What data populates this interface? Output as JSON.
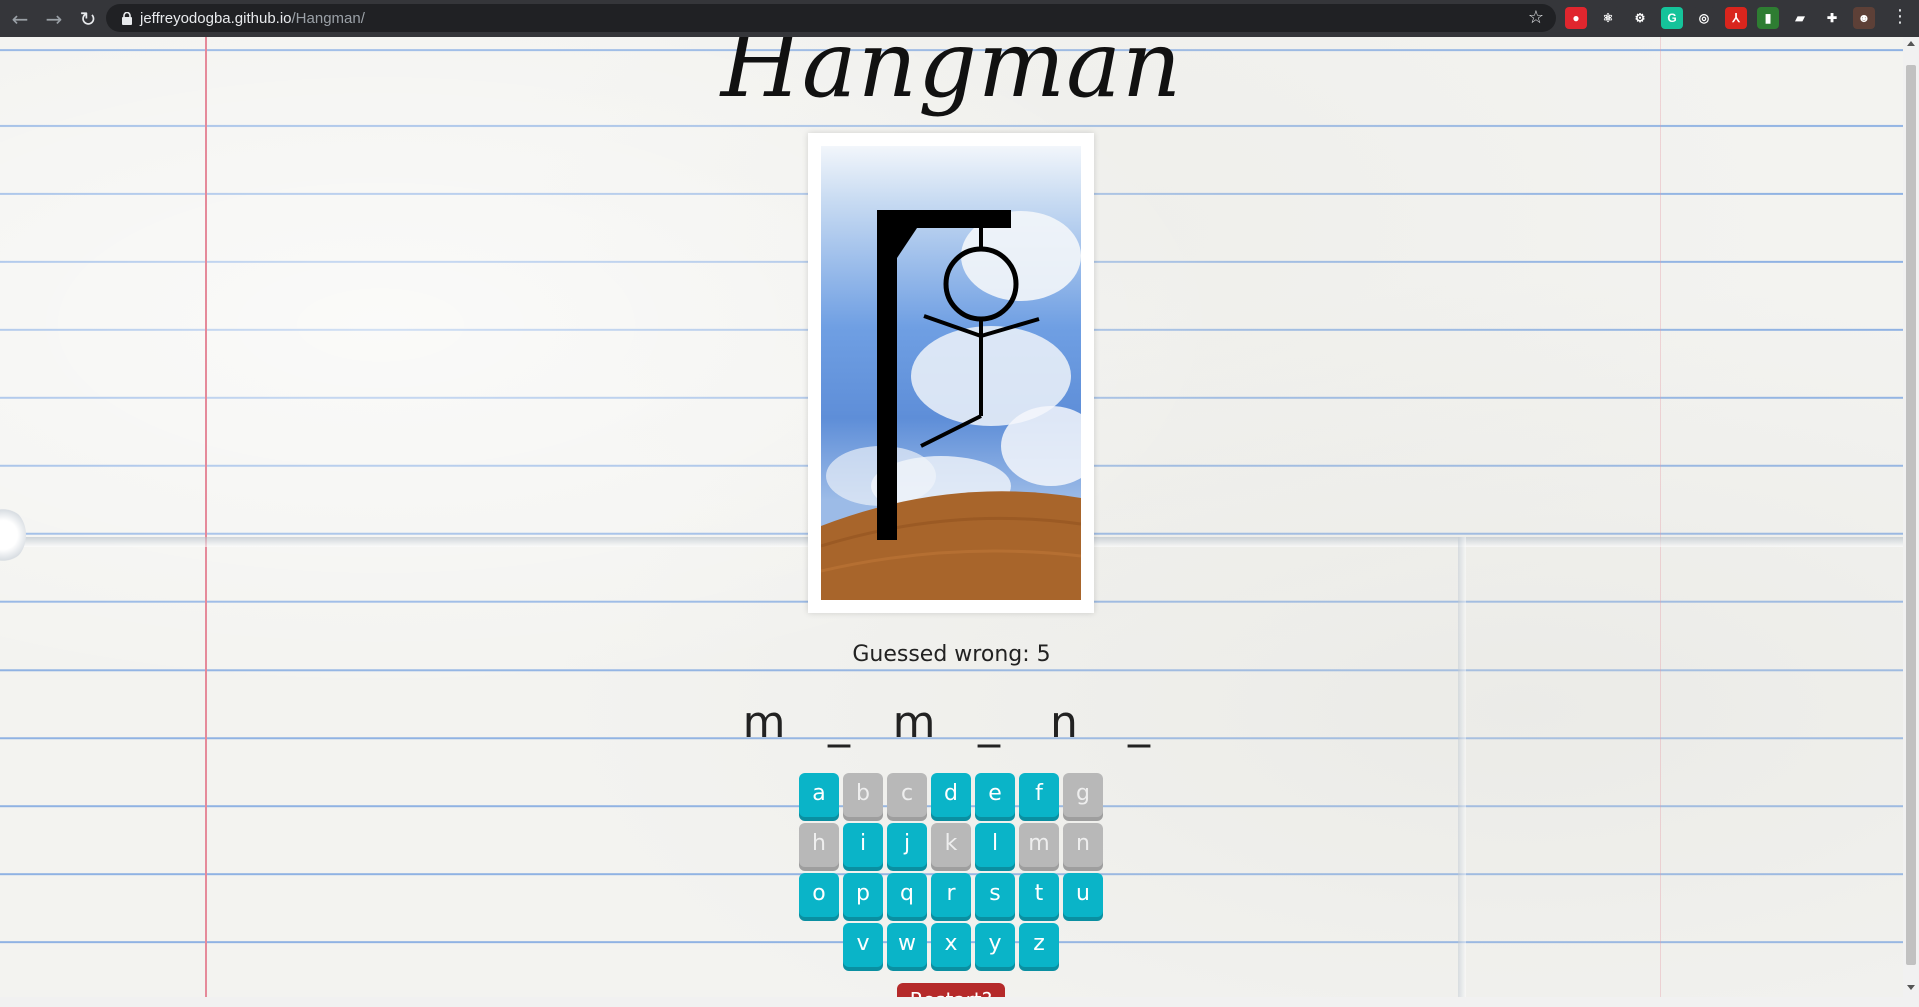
{
  "browser": {
    "url_host": "jeffreyodogba.github.io",
    "url_path": "/Hangman/",
    "extensions": [
      {
        "name": "adblock-icon",
        "color": "#e0262e",
        "glyph": "●"
      },
      {
        "name": "react-devtools-icon",
        "color": "#35363a",
        "glyph": "⚛"
      },
      {
        "name": "gear-extension-icon",
        "color": "#35363a",
        "glyph": "⚙"
      },
      {
        "name": "grammarly-icon",
        "color": "#15c39a",
        "glyph": "G"
      },
      {
        "name": "target-extension-icon",
        "color": "#35363a",
        "glyph": "◎"
      },
      {
        "name": "pdf-extension-icon",
        "color": "#d9251d",
        "glyph": "⅄"
      },
      {
        "name": "chart-extension-icon",
        "color": "#2e7d32",
        "glyph": "▮"
      },
      {
        "name": "tab-extension-icon",
        "color": "#35363a",
        "glyph": "▰"
      },
      {
        "name": "puzzle-extensions-icon",
        "color": "#35363a",
        "glyph": "✚"
      },
      {
        "name": "profile-avatar-icon",
        "color": "#5d4037",
        "glyph": "☻"
      }
    ]
  },
  "game": {
    "title": "Hangman",
    "guessed_wrong_label": "Guessed wrong: 5",
    "word_slots": [
      "m",
      "_",
      "m",
      "_",
      "n",
      "_"
    ],
    "keyboard_rows": [
      [
        {
          "letter": "a",
          "state": "active"
        },
        {
          "letter": "b",
          "state": "used"
        },
        {
          "letter": "c",
          "state": "used"
        },
        {
          "letter": "d",
          "state": "active"
        },
        {
          "letter": "e",
          "state": "active"
        },
        {
          "letter": "f",
          "state": "active"
        },
        {
          "letter": "g",
          "state": "used"
        }
      ],
      [
        {
          "letter": "h",
          "state": "used"
        },
        {
          "letter": "i",
          "state": "active"
        },
        {
          "letter": "j",
          "state": "active"
        },
        {
          "letter": "k",
          "state": "used"
        },
        {
          "letter": "l",
          "state": "active"
        },
        {
          "letter": "m",
          "state": "used"
        },
        {
          "letter": "n",
          "state": "used"
        }
      ],
      [
        {
          "letter": "o",
          "state": "active"
        },
        {
          "letter": "p",
          "state": "active"
        },
        {
          "letter": "q",
          "state": "active"
        },
        {
          "letter": "r",
          "state": "active"
        },
        {
          "letter": "s",
          "state": "active"
        },
        {
          "letter": "t",
          "state": "active"
        },
        {
          "letter": "u",
          "state": "active"
        }
      ],
      [
        {
          "letter": "v",
          "state": "active"
        },
        {
          "letter": "w",
          "state": "active"
        },
        {
          "letter": "x",
          "state": "active"
        },
        {
          "letter": "y",
          "state": "active"
        },
        {
          "letter": "z",
          "state": "active"
        }
      ]
    ],
    "restart_label": "Restart?",
    "colors": {
      "key_active": "#0ab4c8",
      "key_used": "#b8b8b8",
      "restart": "#b52a2a"
    }
  }
}
